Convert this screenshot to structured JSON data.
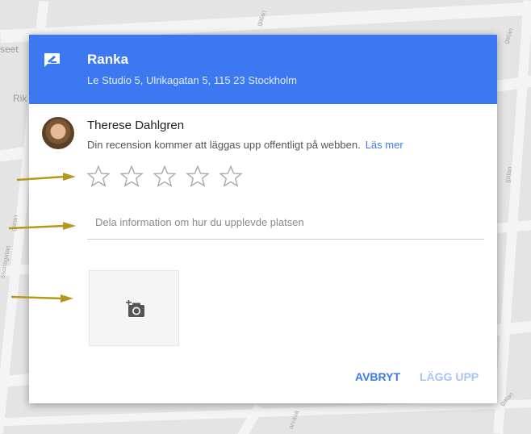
{
  "map": {
    "labels": [
      "seet",
      "Rik",
      "gatan",
      "gatan",
      "gatan",
      "ssonsgatan",
      "gatan",
      "gatan",
      "arvävä"
    ]
  },
  "dialog": {
    "title": "Ranka",
    "address": "Le Studio 5, Ulrikagatan 5, 115 23 Stockholm",
    "user_name": "Therese Dahlgren",
    "notice": "Din recension kommer att läggas upp offentligt på webben.",
    "learn_more": "Läs mer",
    "rating": {
      "max": 5,
      "value": 0
    },
    "review_placeholder": "Dela information om hur du upplevde platsen",
    "cancel_label": "AVBRYT",
    "submit_label": "LÄGG UPP"
  },
  "colors": {
    "header": "#3b78f2",
    "accent": "#3b78f2",
    "disabled_button": "#a9c3f5",
    "annotation_arrow": "#b39a1e",
    "star_outline": "#a6a6a6"
  },
  "icons": {
    "header": "rate-review-icon",
    "photo": "add-photo-icon",
    "star": "star-outline-icon"
  }
}
